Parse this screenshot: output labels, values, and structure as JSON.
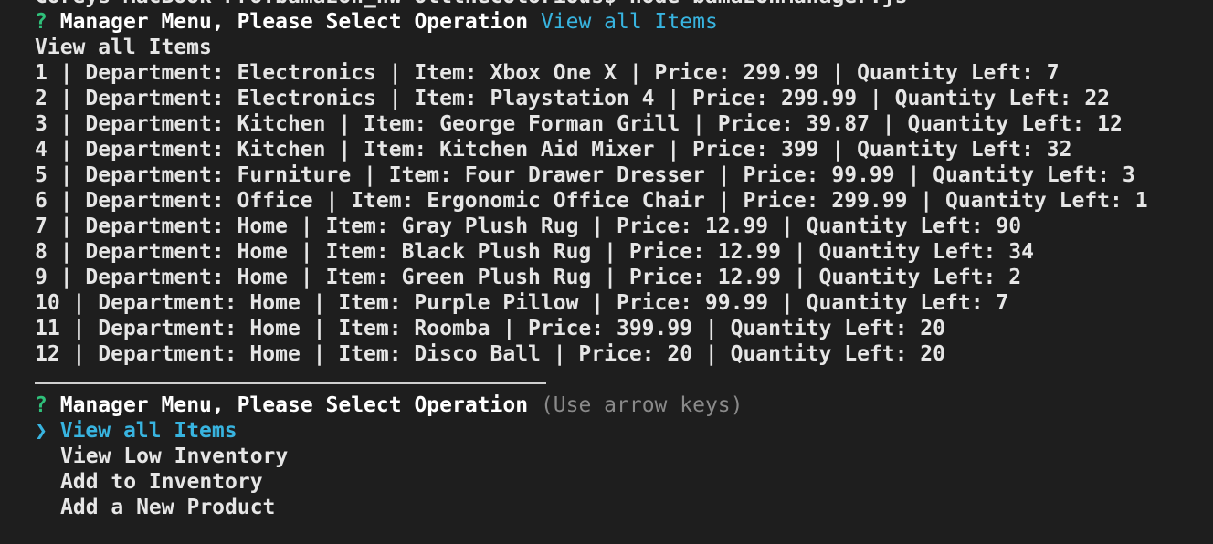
{
  "prompt_line": "Coreys-MacBook-Pro:bamazon_hw ottthecolorious$ node bamazonManager.js",
  "first_prompt": {
    "symbol": "?",
    "question": "Manager Menu, Please Select Operation",
    "answer": "View all Items"
  },
  "echo": "View all Items",
  "items": [
    {
      "text": "1 | Department: Electronics | Item: Xbox One X | Price: 299.99 | Quantity Left: 7"
    },
    {
      "text": "2 | Department: Electronics | Item: Playstation 4 | Price: 299.99 | Quantity Left: 22"
    },
    {
      "text": "3 | Department: Kitchen | Item: George Forman Grill | Price: 39.87 | Quantity Left: 12"
    },
    {
      "text": "4 | Department: Kitchen | Item: Kitchen Aid Mixer | Price: 399 | Quantity Left: 32"
    },
    {
      "text": "5 | Department: Furniture | Item: Four Drawer Dresser | Price: 99.99 | Quantity Left: 3"
    },
    {
      "text": "6 | Department: Office | Item: Ergonomic Office Chair | Price: 299.99 | Quantity Left: 1"
    },
    {
      "text": "7 | Department: Home | Item: Gray Plush Rug | Price: 12.99 | Quantity Left: 90"
    },
    {
      "text": "8 | Department: Home | Item: Black Plush Rug | Price: 12.99 | Quantity Left: 34"
    },
    {
      "text": "9 | Department: Home | Item: Green Plush Rug | Price: 12.99 | Quantity Left: 2"
    },
    {
      "text": "10 | Department: Home | Item: Purple Pillow | Price: 99.99 | Quantity Left: 7"
    },
    {
      "text": "11 | Department: Home | Item: Roomba | Price: 399.99 | Quantity Left: 20"
    },
    {
      "text": "12 | Department: Home | Item: Disco Ball | Price: 20 | Quantity Left: 20"
    }
  ],
  "second_prompt": {
    "symbol": "?",
    "question": "Manager Menu, Please Select Operation",
    "hint": "(Use arrow keys)"
  },
  "menu": {
    "pointer": "❯",
    "options": [
      {
        "label": "View all Items"
      },
      {
        "label": "View Low Inventory"
      },
      {
        "label": "Add to Inventory"
      },
      {
        "label": "Add a New Product"
      }
    ]
  },
  "colors": {
    "background": "#1e1e1e",
    "question_mark": "#2fc07a",
    "highlight": "#38b4e0",
    "hint": "#8a8a8a"
  }
}
